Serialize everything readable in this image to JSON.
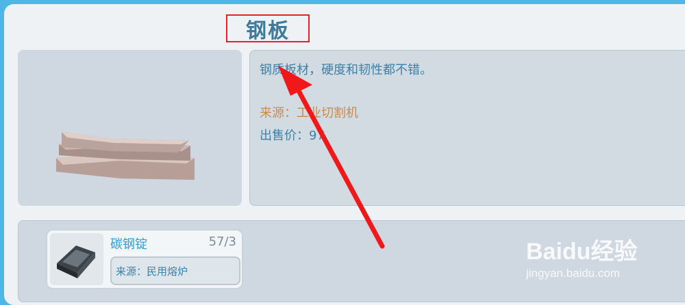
{
  "item": {
    "title": "钢板",
    "description": "钢质板材，硬度和韧性都不错。",
    "source_text": "来源：工业切割机",
    "price_text": "出售价：97"
  },
  "recipe": {
    "name": "碳钢锭",
    "count": "57/3",
    "source_text": "来源：民用熔炉"
  },
  "watermark": {
    "logo": "Baidu经验",
    "url": "jingyan.baidu.com"
  },
  "icons": [
    "steel-plate-icon",
    "carbon-steel-ingot-icon",
    "red-arrow"
  ],
  "colors": {
    "highlight": "#e02424",
    "accent_blue": "#3d80a8",
    "source_orange": "#cc8a4a"
  }
}
